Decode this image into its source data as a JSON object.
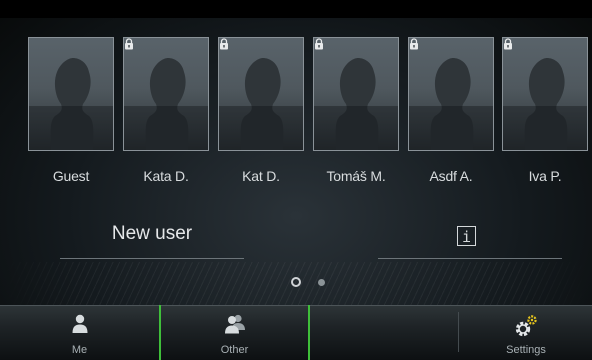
{
  "profiles": [
    {
      "name": "Guest",
      "locked": false
    },
    {
      "name": "Kata D.",
      "locked": true
    },
    {
      "name": "Kat D.",
      "locked": true
    },
    {
      "name": "Tomáš M.",
      "locked": true
    },
    {
      "name": "Asdf A.",
      "locked": true
    },
    {
      "name": "Iva P.",
      "locked": true
    }
  ],
  "new_user_label": "New user",
  "info_button_label": "i",
  "pager": {
    "pages": 2,
    "current": 1
  },
  "bottom_nav": {
    "me_label": "Me",
    "other_label": "Other",
    "settings_label": "Settings"
  },
  "colors": {
    "accent": "#3fbf3a",
    "gear": "#e6c51e"
  }
}
